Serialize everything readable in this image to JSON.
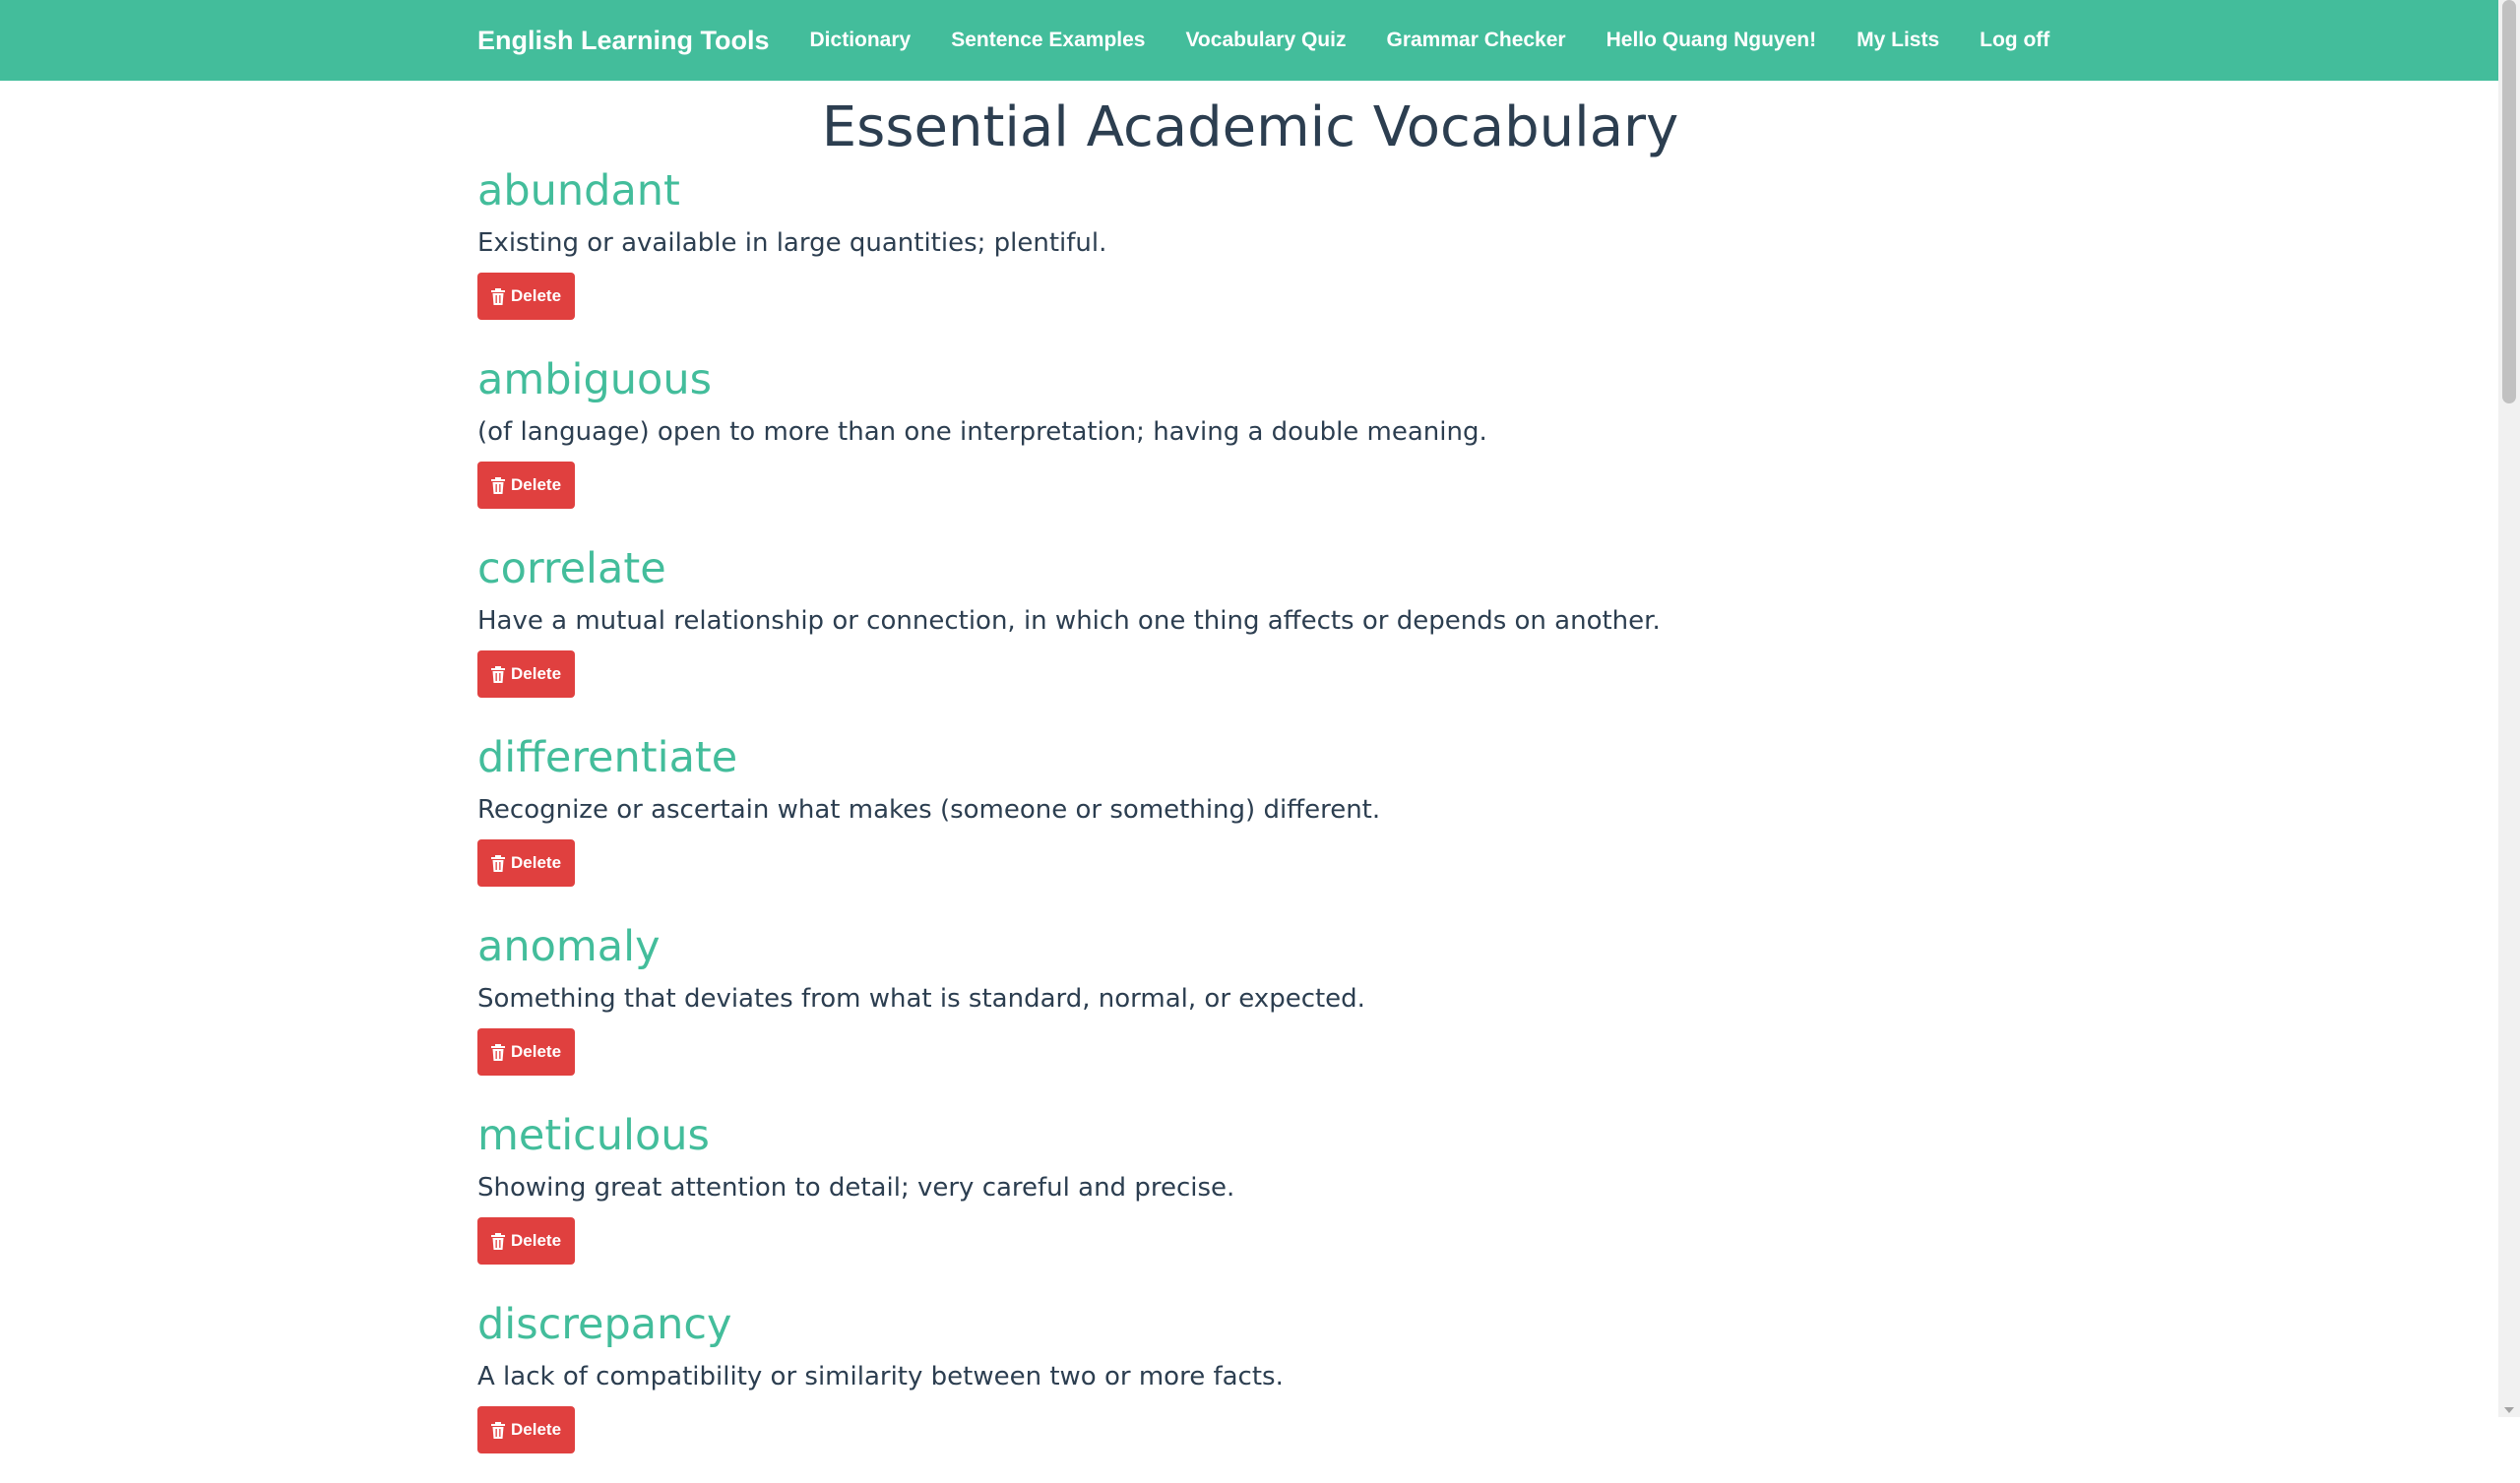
{
  "nav": {
    "brand": "English Learning Tools",
    "links": [
      {
        "label": "Dictionary"
      },
      {
        "label": "Sentence Examples"
      },
      {
        "label": "Vocabulary Quiz"
      },
      {
        "label": "Grammar Checker"
      }
    ],
    "right_links": [
      {
        "label": "Hello Quang Nguyen!"
      },
      {
        "label": "My Lists"
      },
      {
        "label": "Log off"
      }
    ]
  },
  "page": {
    "title": "Essential Academic Vocabulary"
  },
  "entries": [
    {
      "word": "abundant",
      "definition": "Existing or available in large quantities; plentiful.",
      "delete_label": "Delete"
    },
    {
      "word": "ambiguous",
      "definition": "(of language) open to more than one interpretation; having a double meaning.",
      "delete_label": "Delete"
    },
    {
      "word": "correlate",
      "definition": "Have a mutual relationship or connection, in which one thing affects or depends on another.",
      "delete_label": "Delete"
    },
    {
      "word": "differentiate",
      "definition": "Recognize or ascertain what makes (someone or something) different.",
      "delete_label": "Delete"
    },
    {
      "word": "anomaly",
      "definition": "Something that deviates from what is standard, normal, or expected.",
      "delete_label": "Delete"
    },
    {
      "word": "meticulous",
      "definition": "Showing great attention to detail; very careful and precise.",
      "delete_label": "Delete"
    },
    {
      "word": "discrepancy",
      "definition": "A lack of compatibility or similarity between two or more facts.",
      "delete_label": "Delete"
    }
  ],
  "colors": {
    "navbar": "#43bd9b",
    "accent": "#43bd9b",
    "danger": "#e0403f",
    "text": "#2c3e50"
  },
  "icons": {
    "delete": "trash-icon"
  }
}
